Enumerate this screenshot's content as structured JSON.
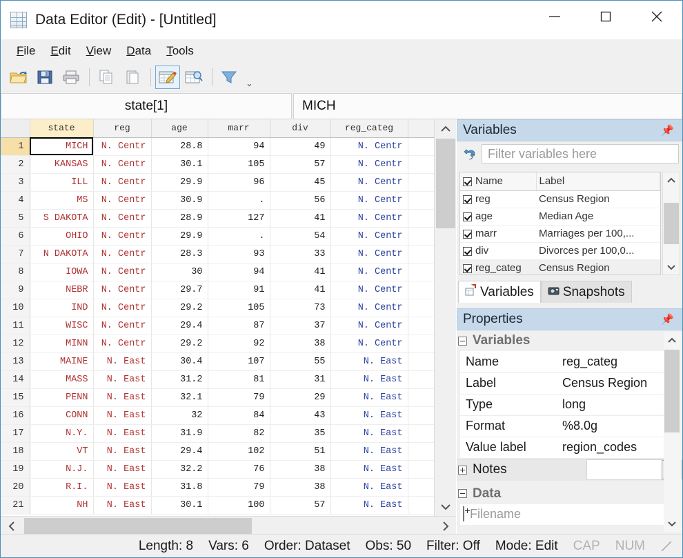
{
  "window": {
    "title": "Data Editor (Edit) - [Untitled]",
    "icon": "grid-icon",
    "minimize": "minimize-icon",
    "maximize": "maximize-icon",
    "close": "close-icon"
  },
  "menubar": {
    "items": [
      {
        "label": "File",
        "accel": "F"
      },
      {
        "label": "Edit",
        "accel": "E"
      },
      {
        "label": "View",
        "accel": "V"
      },
      {
        "label": "Data",
        "accel": "D"
      },
      {
        "label": "Tools",
        "accel": "T"
      }
    ]
  },
  "toolbar": {
    "buttons": [
      {
        "name": "open-icon",
        "title": "Open"
      },
      {
        "name": "save-icon",
        "title": "Save"
      },
      {
        "name": "print-icon",
        "title": "Print"
      },
      {
        "name": "copy-icon",
        "title": "Copy"
      },
      {
        "name": "paste-icon",
        "title": "Paste"
      },
      {
        "name": "data-editor-edit-icon",
        "title": "Data Editor (Edit)",
        "active": true
      },
      {
        "name": "data-editor-browse-icon",
        "title": "Data Editor (Browse)"
      },
      {
        "name": "filter-icon",
        "title": "Filter"
      }
    ],
    "overflow": "more-icon"
  },
  "editbar": {
    "cell_reference": "state[1]",
    "cell_value": "MICH"
  },
  "grid": {
    "columns": [
      "state",
      "reg",
      "age",
      "marr",
      "div",
      "reg_categ"
    ],
    "selected_column": "state",
    "selected_row": 1,
    "rows": [
      {
        "n": "1",
        "state": "MICH",
        "reg": "N. Centr",
        "age": "28.8",
        "marr": "94",
        "div": "49",
        "reg_categ": "N. Centr"
      },
      {
        "n": "2",
        "state": "KANSAS",
        "reg": "N. Centr",
        "age": "30.1",
        "marr": "105",
        "div": "57",
        "reg_categ": "N. Centr"
      },
      {
        "n": "3",
        "state": "ILL",
        "reg": "N. Centr",
        "age": "29.9",
        "marr": "96",
        "div": "45",
        "reg_categ": "N. Centr"
      },
      {
        "n": "4",
        "state": "MS",
        "reg": "N. Centr",
        "age": "30.9",
        "marr": ".",
        "div": "56",
        "reg_categ": "N. Centr"
      },
      {
        "n": "5",
        "state": "S DAKOTA",
        "reg": "N. Centr",
        "age": "28.9",
        "marr": "127",
        "div": "41",
        "reg_categ": "N. Centr"
      },
      {
        "n": "6",
        "state": "OHIO",
        "reg": "N. Centr",
        "age": "29.9",
        "marr": ".",
        "div": "54",
        "reg_categ": "N. Centr"
      },
      {
        "n": "7",
        "state": "N DAKOTA",
        "reg": "N. Centr",
        "age": "28.3",
        "marr": "93",
        "div": "33",
        "reg_categ": "N. Centr"
      },
      {
        "n": "8",
        "state": "IOWA",
        "reg": "N. Centr",
        "age": "30",
        "marr": "94",
        "div": "41",
        "reg_categ": "N. Centr"
      },
      {
        "n": "9",
        "state": "NEBR",
        "reg": "N. Centr",
        "age": "29.7",
        "marr": "91",
        "div": "41",
        "reg_categ": "N. Centr"
      },
      {
        "n": "10",
        "state": "IND",
        "reg": "N. Centr",
        "age": "29.2",
        "marr": "105",
        "div": "73",
        "reg_categ": "N. Centr"
      },
      {
        "n": "11",
        "state": "WISC",
        "reg": "N. Centr",
        "age": "29.4",
        "marr": "87",
        "div": "37",
        "reg_categ": "N. Centr"
      },
      {
        "n": "12",
        "state": "MINN",
        "reg": "N. Centr",
        "age": "29.2",
        "marr": "92",
        "div": "38",
        "reg_categ": "N. Centr"
      },
      {
        "n": "13",
        "state": "MAINE",
        "reg": "N. East",
        "age": "30.4",
        "marr": "107",
        "div": "55",
        "reg_categ": "N. East"
      },
      {
        "n": "14",
        "state": "MASS",
        "reg": "N. East",
        "age": "31.2",
        "marr": "81",
        "div": "31",
        "reg_categ": "N. East"
      },
      {
        "n": "15",
        "state": "PENN",
        "reg": "N. East",
        "age": "32.1",
        "marr": "79",
        "div": "29",
        "reg_categ": "N. East"
      },
      {
        "n": "16",
        "state": "CONN",
        "reg": "N. East",
        "age": "32",
        "marr": "84",
        "div": "43",
        "reg_categ": "N. East"
      },
      {
        "n": "17",
        "state": "N.Y.",
        "reg": "N. East",
        "age": "31.9",
        "marr": "82",
        "div": "35",
        "reg_categ": "N. East"
      },
      {
        "n": "18",
        "state": "VT",
        "reg": "N. East",
        "age": "29.4",
        "marr": "102",
        "div": "51",
        "reg_categ": "N. East"
      },
      {
        "n": "19",
        "state": "N.J.",
        "reg": "N. East",
        "age": "32.2",
        "marr": "76",
        "div": "38",
        "reg_categ": "N. East"
      },
      {
        "n": "20",
        "state": "R.I.",
        "reg": "N. East",
        "age": "31.8",
        "marr": "79",
        "div": "38",
        "reg_categ": "N. East"
      },
      {
        "n": "21",
        "state": "NH",
        "reg": "N. East",
        "age": "30.1",
        "marr": "100",
        "div": "57",
        "reg_categ": "N. East"
      }
    ]
  },
  "variables_panel": {
    "title": "Variables",
    "pin": "pin-icon",
    "filter_placeholder": "Filter variables here",
    "filter_value": "",
    "filter_icon": "wrench-icon",
    "header": {
      "name": "Name",
      "label": "Label"
    },
    "rows": [
      {
        "name": "reg",
        "label": "Census Region",
        "checked": true,
        "selected": false
      },
      {
        "name": "age",
        "label": "Median Age",
        "checked": true,
        "selected": false
      },
      {
        "name": "marr",
        "label": "Marriages per 100,...",
        "checked": true,
        "selected": false
      },
      {
        "name": "div",
        "label": "Divorces per 100,0...",
        "checked": true,
        "selected": false
      },
      {
        "name": "reg_categ",
        "label": "Census Region",
        "checked": true,
        "selected": true
      }
    ],
    "tabs": [
      {
        "label": "Variables",
        "icon": "variables-tab-icon",
        "active": true
      },
      {
        "label": "Snapshots",
        "icon": "camera-icon",
        "active": false
      }
    ]
  },
  "properties_panel": {
    "title": "Properties",
    "pin": "pin-icon",
    "groups": [
      {
        "name": "Variables",
        "rows": [
          {
            "key": "Name",
            "value": "reg_categ"
          },
          {
            "key": "Label",
            "value": "Census Region"
          },
          {
            "key": "Type",
            "value": "long"
          },
          {
            "key": "Format",
            "value": "%8.0g"
          },
          {
            "key": "Value label",
            "value": "region_codes"
          }
        ],
        "notes": {
          "key": "Notes",
          "value": "",
          "button": "..."
        }
      },
      {
        "name": "Data",
        "rows": [
          {
            "key": "Filename",
            "value": ""
          }
        ]
      }
    ]
  },
  "statusbar": {
    "length": "Length: 8",
    "vars": "Vars: 6",
    "order": "Order: Dataset",
    "obs": "Obs: 50",
    "filter": "Filter: Off",
    "mode": "Mode: Edit",
    "cap": "CAP",
    "num": "NUM"
  },
  "colors": {
    "title_border": "#4a90b8",
    "panel_header": "#c6d9ea",
    "selected_column_header": "#fbeec8",
    "selected_row_header": "#f6dfa8",
    "string_value": "#b03030",
    "labeled_value": "#2a3fa0",
    "toolbar_bg": "#f0f0f0"
  }
}
